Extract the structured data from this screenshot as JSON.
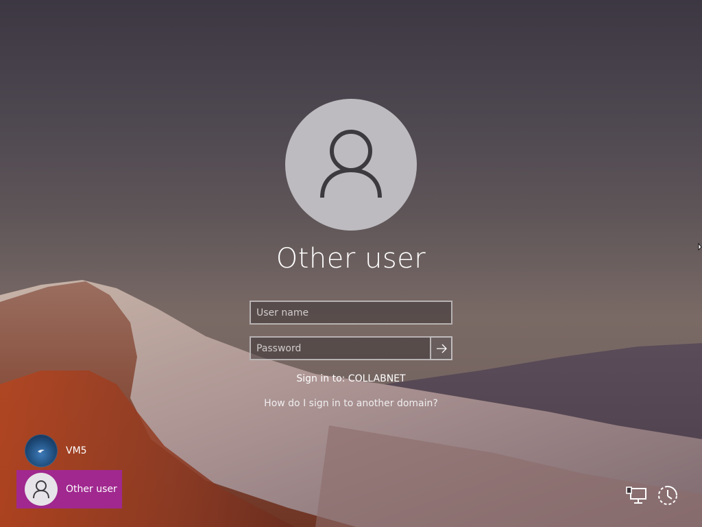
{
  "lock_screen": {
    "selected_user": "Other user",
    "username_placeholder": "User name",
    "password_placeholder": "Password",
    "sign_in_to": "Sign in to: COLLABNET",
    "domain_help_link": "How do I sign in to another domain?"
  },
  "user_list": [
    {
      "label": "VM5",
      "selected": false
    },
    {
      "label": "Other user",
      "selected": true
    }
  ],
  "corner_buttons": {
    "network_icon": "network-icon",
    "accessibility_icon": "ease-of-access-icon"
  },
  "colors": {
    "selected_tile": "#a0288f",
    "avatar_bg": "#bdbbbf"
  }
}
